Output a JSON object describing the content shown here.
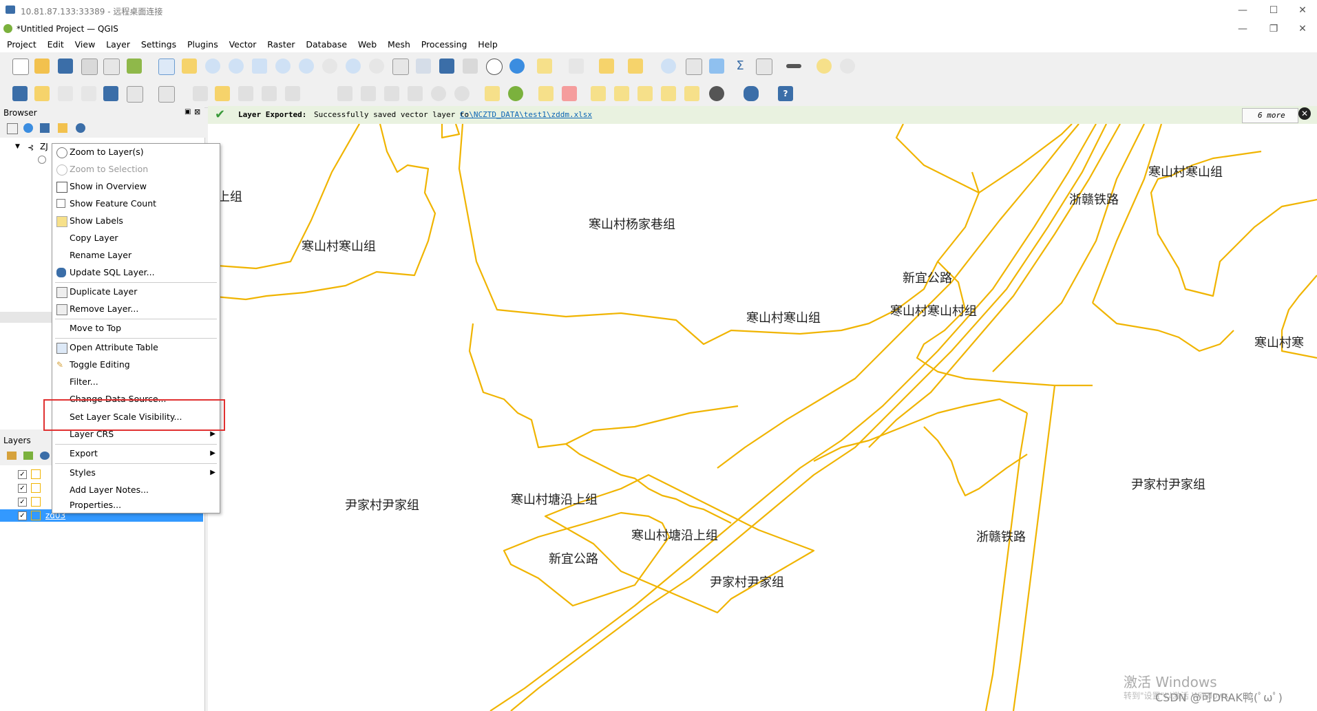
{
  "rdp": {
    "title": "10.81.87.133:33389 - 远程桌面连接"
  },
  "app": {
    "title": "*Untitled Project — QGIS"
  },
  "menu": [
    "Project",
    "Edit",
    "View",
    "Layer",
    "Settings",
    "Plugins",
    "Vector",
    "Raster",
    "Database",
    "Web",
    "Mesh",
    "Processing",
    "Help"
  ],
  "panels": {
    "browser_title": "Browser",
    "layers_title": "Layers",
    "browser_root": "ZJ"
  },
  "message": {
    "title": "Layer Exported:",
    "text": "Successfully saved vector layer to",
    "link": "C:\\NCZTD_DATA\\test1\\zddm.xlsx",
    "more": "6 more"
  },
  "context_menu": {
    "items": [
      {
        "label": "Zoom to Layer(s)",
        "icon": "zoom-icon"
      },
      {
        "label": "Zoom to Selection",
        "icon": "zoom-selection-icon",
        "disabled": true
      },
      {
        "label": "Show in Overview",
        "icon": "overview-icon"
      },
      {
        "label": "Show Feature Count",
        "icon": "checkbox-icon"
      },
      {
        "label": "Show Labels",
        "icon": "labels-icon"
      },
      {
        "label": "Copy Layer"
      },
      {
        "label": "Rename Layer"
      },
      {
        "label": "Update SQL Layer...",
        "icon": "database-icon"
      },
      {
        "label": "Duplicate Layer",
        "icon": "duplicate-icon"
      },
      {
        "label": "Remove Layer...",
        "icon": "remove-icon"
      },
      {
        "label": "Move to Top"
      },
      {
        "label": "Open Attribute Table",
        "icon": "table-icon"
      },
      {
        "label": "Toggle Editing",
        "icon": "pencil-icon"
      },
      {
        "label": "Filter..."
      },
      {
        "label": "Change Data Source..."
      },
      {
        "label": "Set Layer Scale Visibility..."
      },
      {
        "label": "Layer CRS",
        "submenu": true
      },
      {
        "label": "Export",
        "submenu": true
      },
      {
        "label": "Styles",
        "submenu": true
      },
      {
        "label": "Add Layer Notes..."
      },
      {
        "label": "Properties..."
      }
    ]
  },
  "layers": {
    "selected_layer": "zd03"
  },
  "map_labels": [
    "寒山村杨家巷组",
    "寒山村寒山组",
    "寒山村寒山组",
    "新宜公路",
    "寒山村寒山村组",
    "浙赣铁路",
    "寒山村寒山组",
    "寒山村寒",
    "尹家村尹家组",
    "寒山村塘沿上组",
    "寒山村塘沿上组",
    "新宜公路",
    "尹家村尹家组",
    "浙赣铁路",
    "尹家村尹家组",
    "上组"
  ],
  "watermark": {
    "line1": "激活 Windows",
    "line2": "转到\"设置\"以激活 Windows。",
    "credit": "CSDN @可DRAK鸭(ﾟωﾟ)"
  },
  "colors": {
    "polygon_stroke": "#f0b400",
    "highlight": "#e03030",
    "selection": "#3399ff"
  }
}
